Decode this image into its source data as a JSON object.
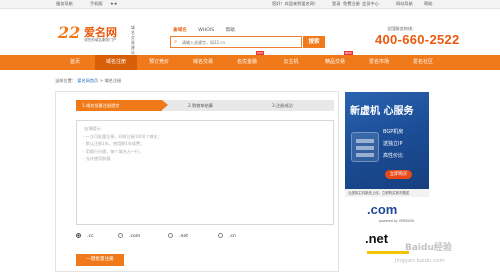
{
  "topbar": {
    "left_links": [
      "服务导航",
      "手机版"
    ],
    "welcome": "您好！欢迎来到爱名网！",
    "login": "登录",
    "register": "免费注册",
    "member_center": "会员中心",
    "right_links": [
      "网站导航",
      "帮助"
    ]
  },
  "logo": {
    "number": "22",
    "name": "爱名网",
    "tagline": "领先的域名服务门户",
    "side_text": [
      "域名",
      "交易",
      "建站"
    ]
  },
  "search": {
    "tabs": [
      "查域名",
      "WHOIS",
      "帮助"
    ],
    "placeholder": "请输入关键字，如22.cn",
    "button": "搜索"
  },
  "hotline": {
    "label": "全国服务热线：",
    "number": "400-660-2522"
  },
  "nav": {
    "items": [
      "首页",
      "域名注册",
      "预订竞价",
      "域名交易",
      "名优金融",
      "云主机",
      "精品交易",
      "爱名市场",
      "爱名社区"
    ],
    "active_index": 1,
    "hot_badges": [
      "HOT",
      "NEW"
    ]
  },
  "breadcrumb": {
    "prefix": "当前位置：",
    "home": "爱名网首页",
    "sep": ">",
    "current": "域名注册"
  },
  "steps": [
    "1.域名批量注册提交",
    "2.购物车结算",
    "3.注册成功"
  ],
  "textarea": {
    "hint_lines": [
      "-友情提示：",
      "- 一次可批量注册，同时注册1000个域名；",
      "- 默认注册1年，使用期1年续费；",
      "- 用换行分隔，每个域名占一行；",
      "- 允许使用前缀"
    ]
  },
  "suffixes": [
    ".cc",
    ".com",
    ".net",
    ".cn"
  ],
  "selected_suffix": 0,
  "register_button": "一键批量注册",
  "ads": {
    "ad1_title": "新虚机 心服务",
    "ad1_lines": [
      "BGP机房",
      "送独立IP",
      "高性价比"
    ],
    "ad1_cta": "立即购买",
    "ad1_caption": "云虚拟主机新品上线，立即购买首次赠送",
    "ad2_text": ".com",
    "ad2_sub": "powered by VERISIGN",
    "ad3_text": ".net"
  },
  "watermark": {
    "brand": "Baidu经验",
    "url": "jingyan.baidu.com"
  },
  "colors": {
    "brand_orange": "#f07a1a",
    "nav_active": "#d95e08",
    "hotline": "#ea5a0f",
    "link_blue": "#1a6bb8"
  }
}
